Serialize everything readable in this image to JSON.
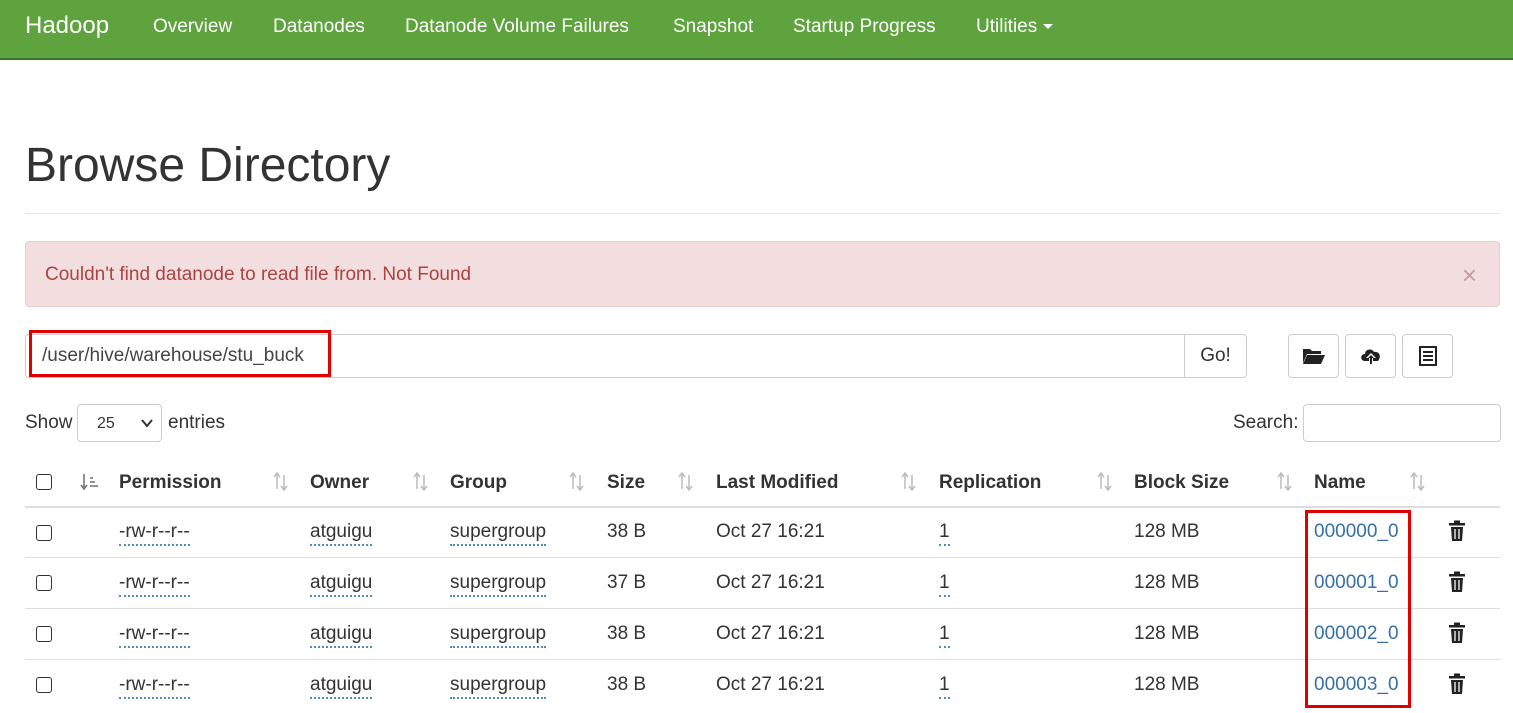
{
  "nav": {
    "brand": "Hadoop",
    "items": [
      "Overview",
      "Datanodes",
      "Datanode Volume Failures",
      "Snapshot",
      "Startup Progress",
      "Utilities"
    ]
  },
  "page": {
    "title": "Browse Directory"
  },
  "alert": {
    "message": "Couldn't find datanode to read file from. Not Found",
    "close": "×"
  },
  "path": {
    "value": "/user/hive/warehouse/stu_buck",
    "go_label": "Go!"
  },
  "toolbar": {
    "icons": [
      "folder-open-icon",
      "upload-cloud-icon",
      "list-icon"
    ]
  },
  "table_controls": {
    "show_label": "Show",
    "page_size": "25",
    "entries_label": "entries",
    "search_label": "Search:"
  },
  "table": {
    "columns": [
      "Permission",
      "Owner",
      "Group",
      "Size",
      "Last Modified",
      "Replication",
      "Block Size",
      "Name"
    ],
    "rows": [
      {
        "permission": "-rw-r--r--",
        "owner": "atguigu",
        "group": "supergroup",
        "size": "38 B",
        "modified": "Oct 27 16:21",
        "replication": "1",
        "block_size": "128 MB",
        "name": "000000_0"
      },
      {
        "permission": "-rw-r--r--",
        "owner": "atguigu",
        "group": "supergroup",
        "size": "37 B",
        "modified": "Oct 27 16:21",
        "replication": "1",
        "block_size": "128 MB",
        "name": "000001_0"
      },
      {
        "permission": "-rw-r--r--",
        "owner": "atguigu",
        "group": "supergroup",
        "size": "38 B",
        "modified": "Oct 27 16:21",
        "replication": "1",
        "block_size": "128 MB",
        "name": "000002_0"
      },
      {
        "permission": "-rw-r--r--",
        "owner": "atguigu",
        "group": "supergroup",
        "size": "38 B",
        "modified": "Oct 27 16:21",
        "replication": "1",
        "block_size": "128 MB",
        "name": "000003_0"
      }
    ]
  },
  "colors": {
    "navbar": "#5fa33e",
    "alert_bg": "#f2dede",
    "alert_text": "#a94442",
    "link": "#3570a8",
    "highlight": "#e00000"
  }
}
